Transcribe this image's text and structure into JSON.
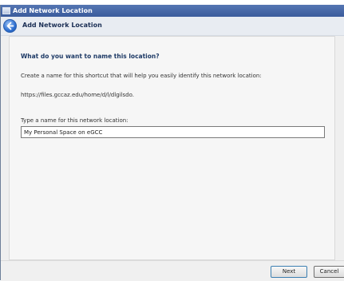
{
  "window": {
    "title": "Add Network Location"
  },
  "header": {
    "title": "Add Network Location"
  },
  "main": {
    "heading": "What do you want to name this location?",
    "description": "Create a name for this shortcut that will help you easily identify this network location:",
    "url": "https://files.gccaz.edu/home/d/l/dlgilsdo.",
    "field_label": "Type a name for this network location:",
    "name_value": "My Personal Space on eGCC"
  },
  "footer": {
    "next_label": "Next",
    "cancel_label": "Cancel"
  },
  "colors": {
    "title_bar": "#3a5b9c",
    "heading_text": "#1e3a66",
    "back_button": "#2d6fd1"
  },
  "icons": {
    "title": "network-folder-icon",
    "back": "back-arrow-icon"
  }
}
